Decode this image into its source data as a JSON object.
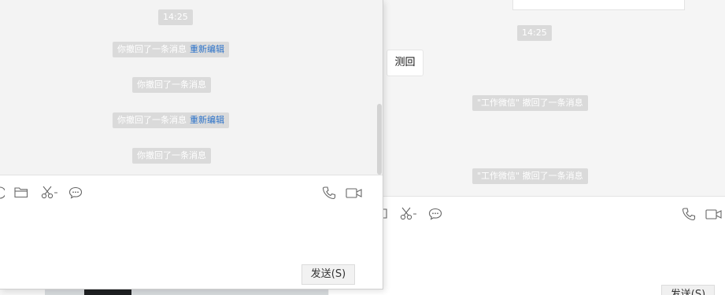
{
  "background_chat": {
    "time_label": "14:25",
    "message_text": "测回",
    "system_notices": [
      "\"工作微信\" 撤回了一条消息",
      "\"工作微信\" 撤回了一条消息"
    ],
    "toolbar_icons": [
      "calendar-icon",
      "scissors-icon",
      "chat-bubble-icon",
      "phone-icon",
      "video-icon"
    ],
    "send_label": "发送(S)"
  },
  "foreground_chat": {
    "time_label": "14:25",
    "recall_notices": [
      {
        "text": "你撤回了一条消息",
        "action": "重新编辑"
      },
      {
        "text": "你撤回了一条消息",
        "action": ""
      },
      {
        "text": "你撤回了一条消息",
        "action": "重新编辑"
      },
      {
        "text": "你撤回了一条消息",
        "action": ""
      }
    ],
    "toolbar_icons": [
      "emoji-icon",
      "folder-icon",
      "scissors-icon",
      "chat-bubble-icon",
      "phone-icon",
      "video-icon"
    ],
    "send_label": "发送(S)"
  },
  "colors": {
    "pill_bg": "#dadada",
    "link_blue": "#2b72c9",
    "window_bg": "#f3f3f3"
  }
}
